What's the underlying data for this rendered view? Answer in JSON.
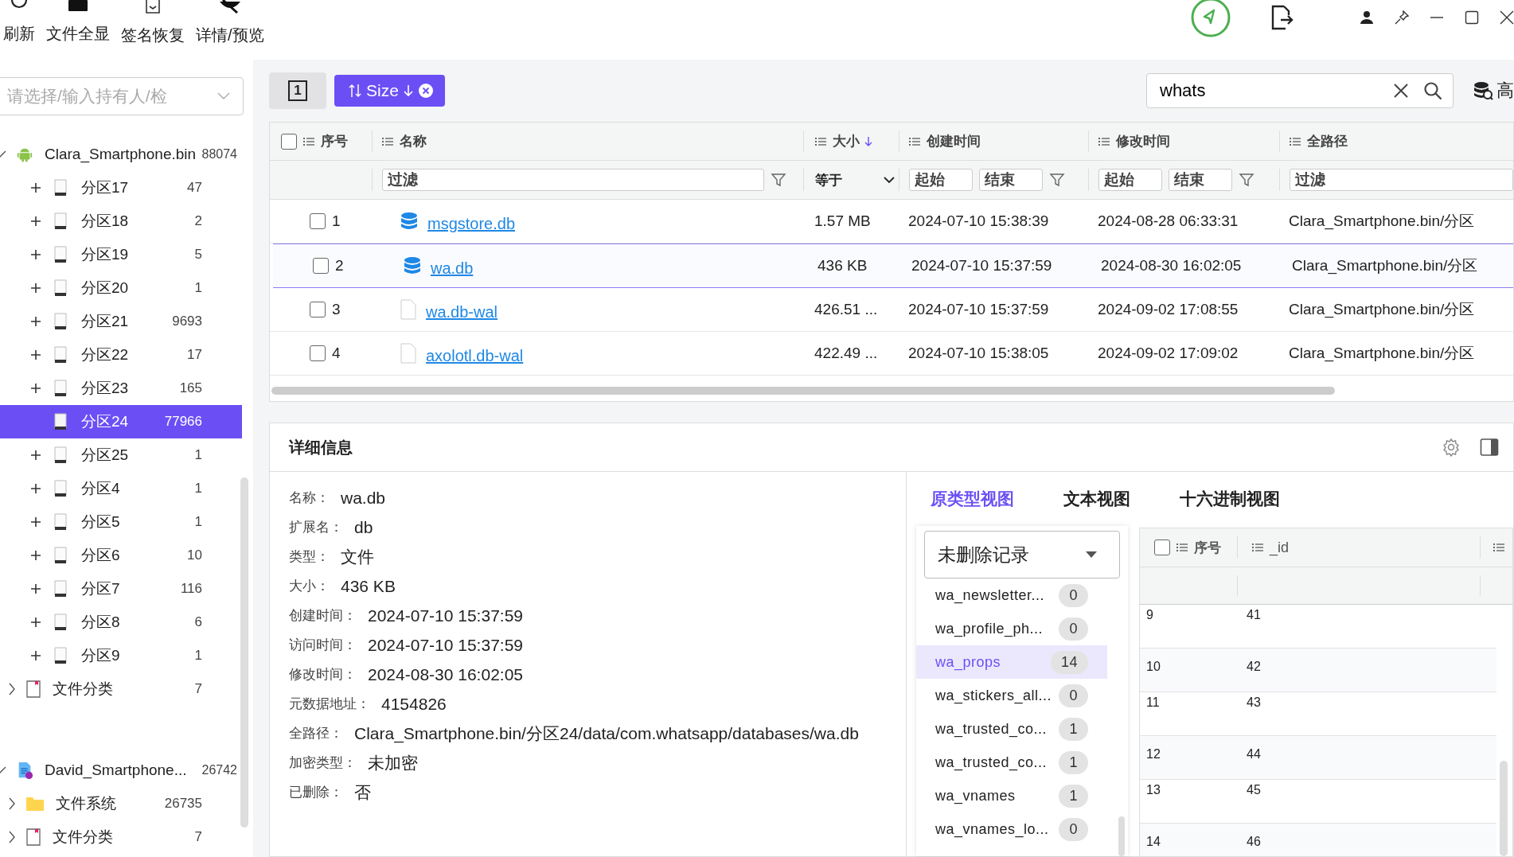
{
  "toolbar": {
    "buttons": [
      {
        "label": "刷新"
      },
      {
        "label": "文件全显"
      },
      {
        "label": "签名恢复"
      },
      {
        "label": "详情/预览"
      }
    ]
  },
  "holder_select": {
    "placeholder": "请选择/输入持有人/检"
  },
  "tree": [
    {
      "label": "Clara_Smartphone.bin",
      "count": "88074",
      "kind": "device",
      "expanded": true,
      "children": [
        {
          "label": "分区17",
          "count": "47",
          "kind": "partition",
          "expanded": false,
          "selected": false
        },
        {
          "label": "分区18",
          "count": "2",
          "kind": "partition",
          "expanded": false,
          "selected": false
        },
        {
          "label": "分区19",
          "count": "5",
          "kind": "partition",
          "expanded": false,
          "selected": false
        },
        {
          "label": "分区20",
          "count": "1",
          "kind": "partition",
          "expanded": false,
          "selected": false
        },
        {
          "label": "分区21",
          "count": "9693",
          "kind": "partition",
          "expanded": false,
          "selected": false
        },
        {
          "label": "分区22",
          "count": "17",
          "kind": "partition",
          "expanded": false,
          "selected": false
        },
        {
          "label": "分区23",
          "count": "165",
          "kind": "partition",
          "expanded": false,
          "selected": false
        },
        {
          "label": "分区24",
          "count": "77966",
          "kind": "partition",
          "selected": true
        },
        {
          "label": "分区25",
          "count": "1",
          "kind": "partition",
          "expanded": false,
          "selected": false
        },
        {
          "label": "分区4",
          "count": "1",
          "kind": "partition",
          "expanded": false,
          "selected": false
        },
        {
          "label": "分区5",
          "count": "1",
          "kind": "partition",
          "expanded": false,
          "selected": false
        },
        {
          "label": "分区6",
          "count": "10",
          "kind": "partition",
          "expanded": false,
          "selected": false
        },
        {
          "label": "分区7",
          "count": "116",
          "kind": "partition",
          "expanded": false,
          "selected": false
        },
        {
          "label": "分区8",
          "count": "6",
          "kind": "partition",
          "expanded": false,
          "selected": false
        },
        {
          "label": "分区9",
          "count": "1",
          "kind": "partition",
          "expanded": false,
          "selected": false
        },
        {
          "label": "文件分类",
          "count": "7",
          "kind": "category",
          "expanded": false,
          "selected": false
        }
      ]
    },
    {
      "label": "David_Smartphone...",
      "count": "26742",
      "kind": "document",
      "expanded": true,
      "children": [
        {
          "label": "文件系统",
          "count": "26735",
          "kind": "folder",
          "expanded": false,
          "selected": false
        },
        {
          "label": "文件分类",
          "count": "7",
          "kind": "category",
          "expanded": false,
          "selected": false
        }
      ]
    }
  ],
  "view_button": {
    "label": "1"
  },
  "sort_chip": {
    "label": "Size",
    "descending": true
  },
  "search": {
    "value": "whats"
  },
  "advanced_button": {
    "label": "高"
  },
  "table": {
    "columns": [
      {
        "label": "序号"
      },
      {
        "label": "名称"
      },
      {
        "label": "大小",
        "sorted_descending": true
      },
      {
        "label": "创建时间"
      },
      {
        "label": "修改时间"
      },
      {
        "label": "全路径"
      }
    ],
    "filters": {
      "name": "过滤",
      "size": "等于",
      "created_start": "起始",
      "created_end": "结束",
      "modified_start": "起始",
      "modified_end": "结束",
      "path": "过滤"
    },
    "header_checked": false,
    "rows": [
      {
        "index": "1",
        "name": "msgstore.db",
        "kind": "database",
        "size": "1.57 MB",
        "created": "2024-07-10 15:38:39",
        "modified": "2024-08-28 06:33:31",
        "path": "Clara_Smartphone.bin/分区",
        "checked": false,
        "selected": false
      },
      {
        "index": "2",
        "name": "wa.db",
        "kind": "database",
        "size": "436 KB",
        "created": "2024-07-10 15:37:59",
        "modified": "2024-08-30 16:02:05",
        "path": "Clara_Smartphone.bin/分区",
        "checked": false,
        "selected": true
      },
      {
        "index": "3",
        "name": "wa.db-wal",
        "kind": "file",
        "size": "426.51 ...",
        "created": "2024-07-10 15:37:59",
        "modified": "2024-09-02 17:08:55",
        "path": "Clara_Smartphone.bin/分区",
        "checked": false,
        "selected": false
      },
      {
        "index": "4",
        "name": "axolotl.db-wal",
        "kind": "file",
        "size": "422.49 ...",
        "created": "2024-07-10 15:38:05",
        "modified": "2024-09-02 17:09:02",
        "path": "Clara_Smartphone.bin/分区",
        "checked": false,
        "selected": false
      }
    ]
  },
  "details": {
    "title": "详细信息",
    "fields": [
      {
        "label": "名称：",
        "value": "wa.db"
      },
      {
        "label": "扩展名：",
        "value": "db"
      },
      {
        "label": "类型：",
        "value": "文件"
      },
      {
        "label": "大小：",
        "value": "436 KB"
      },
      {
        "label": "创建时间：",
        "value": "2024-07-10 15:37:59"
      },
      {
        "label": "访问时间：",
        "value": "2024-07-10 15:37:59"
      },
      {
        "label": "修改时间：",
        "value": "2024-08-30 16:02:05"
      },
      {
        "label": "元数据地址：",
        "value": "4154826"
      },
      {
        "label": "全路径：",
        "value": "Clara_Smartphone.bin/分区24/data/com.whatsapp/databases/wa.db"
      },
      {
        "label": "加密类型：",
        "value": "未加密"
      },
      {
        "label": "已删除：",
        "value": "否"
      }
    ]
  },
  "preview": {
    "tabs": [
      {
        "label": "原类型视图",
        "selected": true
      },
      {
        "label": "文本视图",
        "selected": false
      },
      {
        "label": "十六进制视图",
        "selected": false
      }
    ],
    "record_filter": {
      "value": "未删除记录"
    },
    "db_tables": [
      {
        "name": "wa_newsletter...",
        "count": "0",
        "selected": false
      },
      {
        "name": "wa_profile_ph...",
        "count": "0",
        "selected": false
      },
      {
        "name": "wa_props",
        "count": "14",
        "selected": true
      },
      {
        "name": "wa_stickers_all...",
        "count": "0",
        "selected": false
      },
      {
        "name": "wa_trusted_co...",
        "count": "1",
        "selected": false
      },
      {
        "name": "wa_trusted_co...",
        "count": "1",
        "selected": false
      },
      {
        "name": "wa_vnames",
        "count": "1",
        "selected": false
      },
      {
        "name": "wa_vnames_lo...",
        "count": "0",
        "selected": false
      }
    ],
    "grid": {
      "header_checked": false,
      "columns": [
        {
          "label": "序号"
        },
        {
          "label": "_id"
        }
      ],
      "rows": [
        {
          "index": "9",
          "id": "41"
        },
        {
          "index": "10",
          "id": "42"
        },
        {
          "index": "11",
          "id": "43"
        },
        {
          "index": "12",
          "id": "44"
        },
        {
          "index": "13",
          "id": "45"
        },
        {
          "index": "14",
          "id": "46"
        }
      ]
    }
  }
}
